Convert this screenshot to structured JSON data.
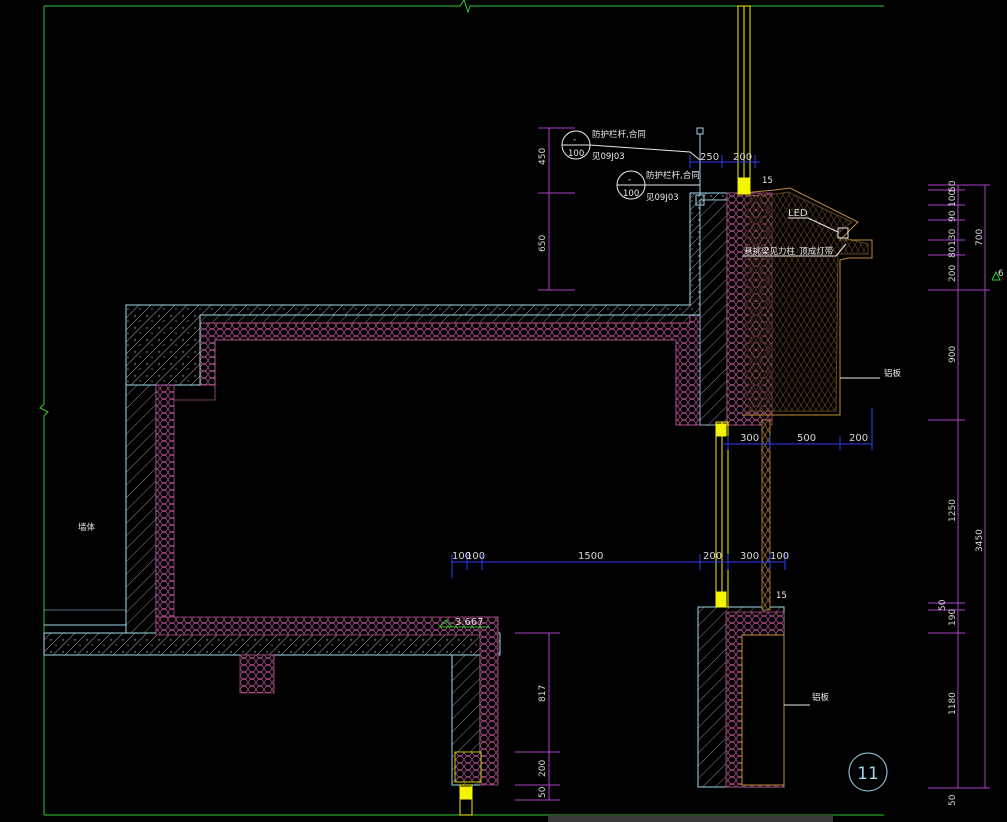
{
  "drawing": {
    "colors": {
      "background": "#000000",
      "wall_outline": "#9fd7ee",
      "insulation": "#b0508a",
      "concrete_hatch": "#b8b8b8",
      "frame_green": "#2ecc2e",
      "dim_blue": "#2b3ef5",
      "dim_purple": "#b040c8",
      "frame_yellow": "#f5f500",
      "flashing": "#c08a3a",
      "callout": "#e8e8e8"
    },
    "level_mark": "3.667",
    "detail_number": "11",
    "right_level": "6",
    "callouts": {
      "top_ref_1": {
        "line1": "防护栏杆,合同",
        "line2": "见09J03",
        "circle_top": "-",
        "circle_bottom": "100"
      },
      "top_ref_2": {
        "line1": "防护栏杆,合同",
        "line2": "见09J03",
        "circle_top": "-",
        "circle_bottom": "100"
      },
      "led": "LED",
      "lighting_note": "悬挑梁见力柱_顶成灯带",
      "left_note": "墙体",
      "slab_note_upper": "铝板",
      "slab_note_lower": "铝板"
    },
    "dims_top_vertical": [
      "450",
      "650"
    ],
    "dims_top_horizontal": [
      "250",
      "200"
    ],
    "dims_mid_horizontal": [
      "300",
      "500",
      "200"
    ],
    "dims_lower_horizontal": [
      "100",
      "100",
      "1500",
      "200",
      "300",
      "100"
    ],
    "dims_small": [
      "15",
      "15"
    ],
    "dims_lower_vertical": [
      "817",
      "200",
      "50"
    ],
    "dims_right_inner": [
      "50",
      "100",
      "90",
      "130",
      "80",
      "200",
      "900",
      "1250",
      "50",
      "190",
      "1180",
      "50"
    ],
    "dims_right_outer": [
      "700",
      "3450"
    ]
  }
}
